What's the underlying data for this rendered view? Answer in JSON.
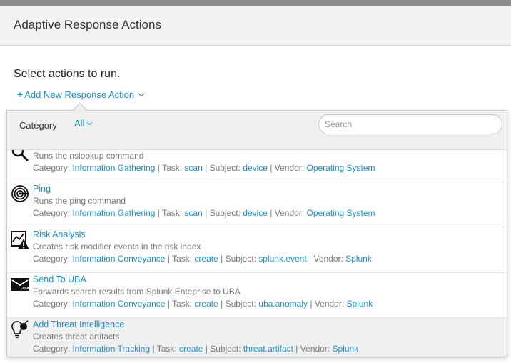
{
  "modal": {
    "title": "Adaptive Response Actions"
  },
  "section": {
    "title": "Select actions to run."
  },
  "add_action": {
    "plus": "+",
    "label": "Add New Response Action"
  },
  "filter": {
    "category_label": "Category",
    "category_value": "All",
    "search_placeholder": "Search"
  },
  "meta_labels": {
    "category": "Category:",
    "task": "Task:",
    "subject": "Subject:",
    "vendor": "Vendor:",
    "sep": "|"
  },
  "actions": [
    {
      "name": "",
      "icon": "magnifier-icon",
      "description": "Runs the nslookup command",
      "category": "Information Gathering",
      "task": "scan",
      "subject": "device",
      "vendor": "Operating System"
    },
    {
      "name": "Ping",
      "icon": "ping-icon",
      "description": "Runs the ping command",
      "category": "Information Gathering",
      "task": "scan",
      "subject": "device",
      "vendor": "Operating System"
    },
    {
      "name": "Risk Analysis",
      "icon": "risk-warning-icon",
      "description": "Creates risk modifier events in the risk index",
      "category": "Information Conveyance",
      "task": "create",
      "subject": "splunk.event",
      "vendor": "Splunk"
    },
    {
      "name": "Send To UBA",
      "icon": "uba-icon",
      "description": "Forwards search results from Splunk Enteprise to UBA",
      "category": "Information Conveyance",
      "task": "create",
      "subject": "uba.anomaly",
      "vendor": "Splunk"
    },
    {
      "name": "Add Threat Intelligence",
      "icon": "lightbulb-bomb-icon",
      "description": "Creates threat artifacts",
      "category": "Information Tracking",
      "task": "create",
      "subject": "threat.artifact",
      "vendor": "Splunk"
    }
  ],
  "colors": {
    "link": "#1a8fc9",
    "header_bg": "#f2f2f2",
    "selected_row": "#f0f0f0"
  }
}
